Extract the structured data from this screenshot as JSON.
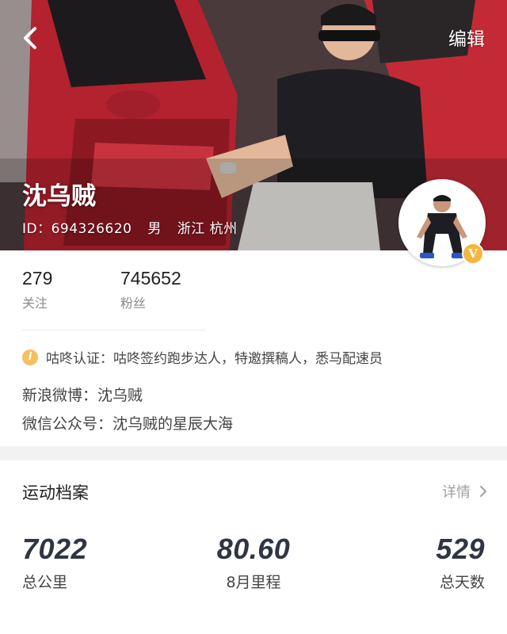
{
  "header": {
    "back_icon": "chevron-left-icon",
    "edit_label": "编辑"
  },
  "profile": {
    "nickname": "沈乌贼",
    "id_text": "ID：694326620",
    "gender": "男",
    "location": "浙江 杭州",
    "verified_badge": "V",
    "badge_color": "#f4b63f"
  },
  "stats": {
    "following_count": "279",
    "following_label": "关注",
    "fans_count": "745652",
    "fans_label": "粉丝"
  },
  "info": {
    "certification": "咕咚认证：咕咚签约跑步达人，特邀撰稿人，悉马配速员",
    "weibo": "新浪微博：沈乌贼",
    "wechat": "微信公众号：沈乌贼的星辰大海"
  },
  "sports_profile": {
    "title": "运动档案",
    "detail_label": "详情",
    "metrics": [
      {
        "value": "7022",
        "label": "总公里"
      },
      {
        "value": "80.60",
        "label": "8月里程"
      },
      {
        "value": "529",
        "label": "总天数"
      }
    ]
  }
}
